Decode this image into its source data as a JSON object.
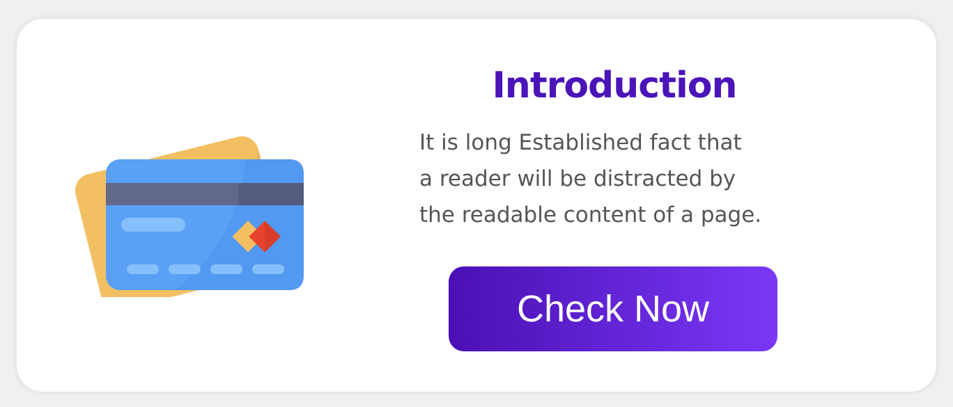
{
  "intro_card": {
    "title": "Introduction",
    "description_lines": [
      "It is long Established fact that",
      "a reader will be distracted by",
      "the readable content of a page."
    ],
    "button_label": "Check Now",
    "illustration_icon": "credit-card-icon"
  },
  "colors": {
    "title": "#4a14b8",
    "button_gradient_start": "#4a10b4",
    "button_gradient_end": "#7a38f6",
    "card_front": "#5ea3f7",
    "card_back": "#f2c063"
  }
}
